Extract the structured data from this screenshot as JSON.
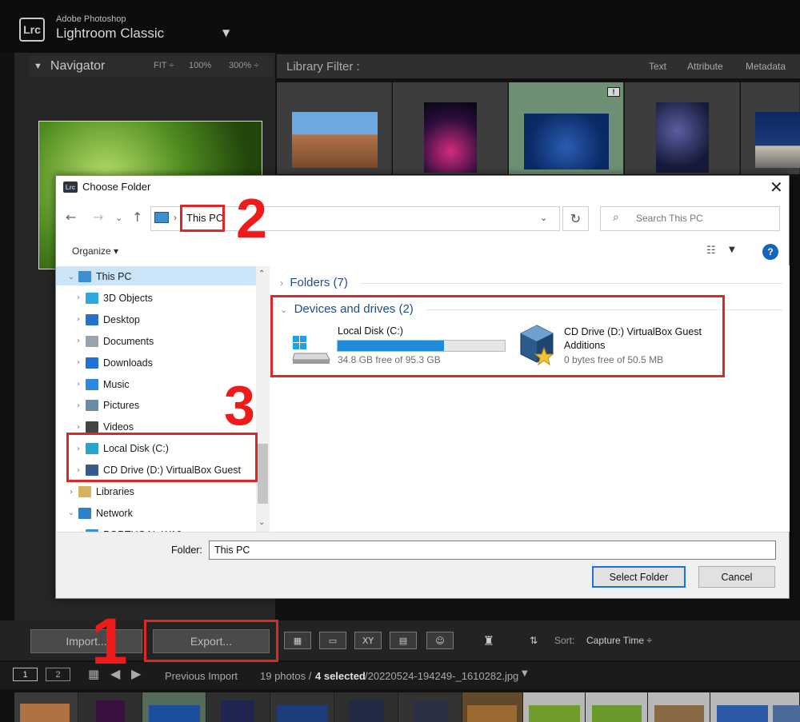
{
  "app": {
    "brand": "Adobe Photoshop",
    "product": "Lightroom Classic",
    "logo_text": "Lrc"
  },
  "navigator": {
    "title": "Navigator",
    "options": [
      "FIT ÷",
      "100%",
      "300% ÷"
    ]
  },
  "library_filter": {
    "title": "Library Filter :",
    "options": [
      "Text",
      "Attribute",
      "Metadata"
    ]
  },
  "toolbar": {
    "import_label": "Import...",
    "export_label": "Export...",
    "sort_label": "Sort:",
    "sort_value": "Capture Time ÷"
  },
  "filmstrip": {
    "source": "Previous Import",
    "photo_count": "19 photos /",
    "selected": "4 selected",
    "filename": "/20220524-194249-_1610282.jpg"
  },
  "dialog": {
    "title": "Choose Folder",
    "address": "This PC",
    "search_placeholder": "Search This PC",
    "organize_label": "Organize ▾",
    "tree": [
      {
        "label": "This PC",
        "chevron": "⌄",
        "color": "#3d8fd4"
      },
      {
        "label": "3D Objects",
        "chevron": "›",
        "color": "#2ea8e0"
      },
      {
        "label": "Desktop",
        "chevron": "›",
        "color": "#2573c9"
      },
      {
        "label": "Documents",
        "chevron": "›",
        "color": "#9aa3ad"
      },
      {
        "label": "Downloads",
        "chevron": "›",
        "color": "#1f73d6"
      },
      {
        "label": "Music",
        "chevron": "›",
        "color": "#2f86e0"
      },
      {
        "label": "Pictures",
        "chevron": "›",
        "color": "#6b8aa8"
      },
      {
        "label": "Videos",
        "chevron": "›",
        "color": "#444"
      },
      {
        "label": "Local Disk (C:)",
        "chevron": "›",
        "color": "#28a3c9"
      },
      {
        "label": "CD Drive (D:) VirtualBox Guest",
        "chevron": "›",
        "color": "#335c8a"
      },
      {
        "label": "Libraries",
        "chevron": "›",
        "color": "#d8b25a"
      },
      {
        "label": "Network",
        "chevron": "⌄",
        "color": "#2f7fc9"
      },
      {
        "label": "PORTUGAL-W10",
        "chevron": "›",
        "color": "#3d8fd4"
      }
    ],
    "folders_header": "Folders (7)",
    "devices_header": "Devices and drives (2)",
    "drive_c": {
      "name": "Local Disk (C:)",
      "free": "34.8 GB free of 95.3 GB",
      "used_fraction": 0.635
    },
    "drive_d": {
      "name": "CD Drive (D:) VirtualBox Guest Additions",
      "free": "0 bytes free of 50.5 MB"
    },
    "folder_label": "Folder:",
    "folder_value": "This PC",
    "select_button": "Select Folder",
    "cancel_button": "Cancel"
  },
  "annotations": {
    "step1": "1",
    "step2": "2",
    "step3": "3"
  },
  "colors": {
    "accent": "#1a73d9",
    "annotation": "#e02727",
    "link_blue": "#1f4e8c"
  }
}
